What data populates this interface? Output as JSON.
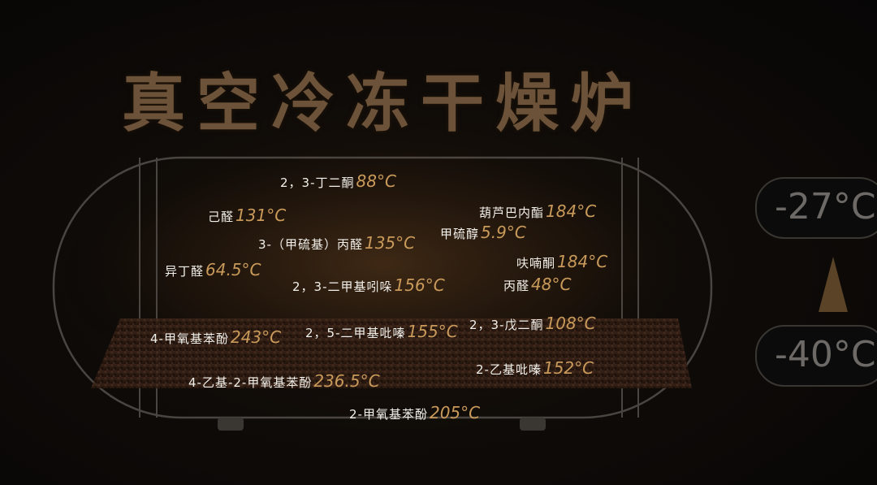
{
  "title": "真空冷冻干燥炉",
  "readings": {
    "upper_temp": "-27°C",
    "lower_temp": "-40°C",
    "arrow": "up-triangle-icon"
  },
  "compounds": [
    {
      "name": "2，3-丁二酮",
      "temp": "88°C"
    },
    {
      "name": "己醛",
      "temp": "131°C"
    },
    {
      "name": "葫芦巴内酯",
      "temp": "184°C"
    },
    {
      "name": "3-（甲硫基）丙醛",
      "temp": "135°C"
    },
    {
      "name": "甲硫醇",
      "temp": "5.9°C"
    },
    {
      "name": "呋喃酮",
      "temp": "184°C"
    },
    {
      "name": "异丁醛",
      "temp": "64.5°C"
    },
    {
      "name": "2，3-二甲基吲哚",
      "temp": "156°C"
    },
    {
      "name": "丙醛",
      "temp": "48°C"
    },
    {
      "name": "4-甲氧基苯酚",
      "temp": "243°C"
    },
    {
      "name": "2，5-二甲基吡嗪",
      "temp": "155°C"
    },
    {
      "name": "2，3-戊二酮",
      "temp": "108°C"
    },
    {
      "name": "2-乙基吡嗪",
      "temp": "152°C"
    },
    {
      "name": "4-乙基-2-甲氧基苯酚",
      "temp": "236.5°C"
    },
    {
      "name": "2-甲氧基苯酚",
      "temp": "205°C"
    }
  ],
  "colors": {
    "label_text": "#f2f0ea",
    "temperature_text": "#c99a5a",
    "title": "#6b5238",
    "tank_outline": "#4a4540"
  }
}
